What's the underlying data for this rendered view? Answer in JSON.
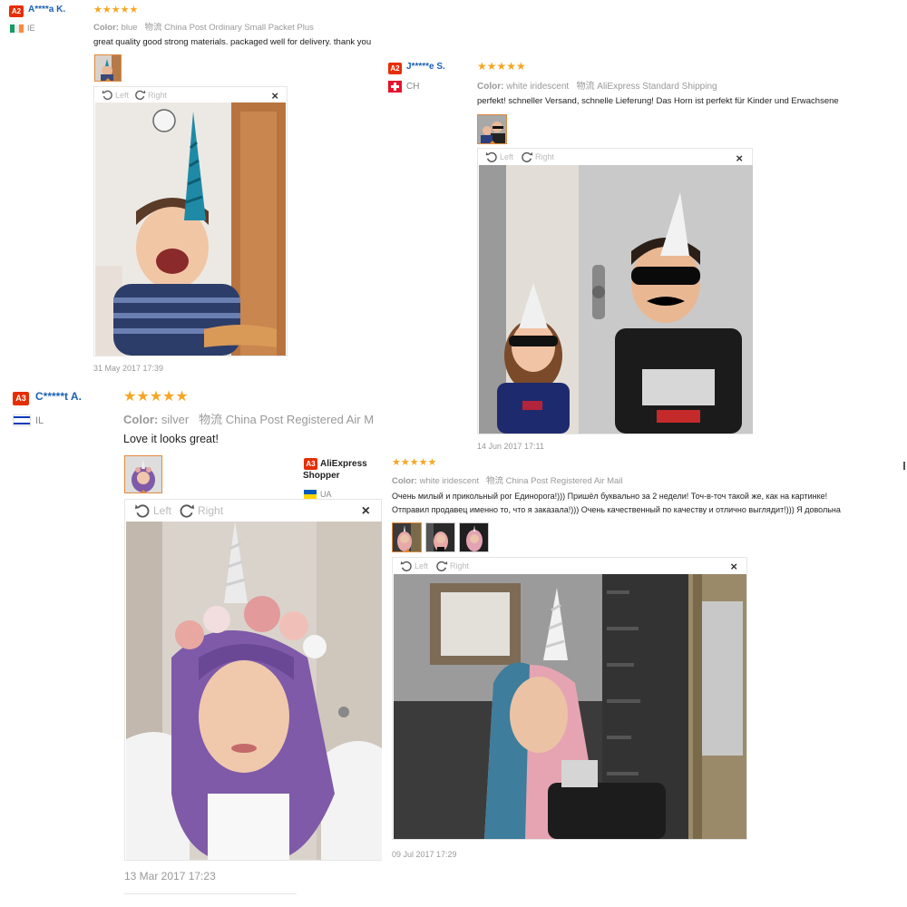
{
  "reviews": [
    {
      "badge": "A2",
      "name": "A****a K.",
      "country": "IE",
      "stars": "★★★★★",
      "color_label": "Color:",
      "color_value": "blue",
      "ship_icon": "物流",
      "shipping": "China Post Ordinary Small Packet Plus",
      "text": "great quality good strong materials. packaged well for delivery. thank you",
      "viewer": {
        "left": "Left",
        "right": "Right",
        "close": "×"
      },
      "date": "31 May 2017 17:39"
    },
    {
      "badge": "A2",
      "name": "J*****e S.",
      "country": "CH",
      "stars": "★★★★★",
      "color_label": "Color:",
      "color_value": "white iridescent",
      "ship_icon": "物流",
      "shipping": "AliExpress Standard Shipping",
      "text": "perfekt! schneller Versand, schnelle Lieferung! Das Horn ist perfekt für Kinder und Erwachsene",
      "viewer": {
        "left": "Left",
        "right": "Right",
        "close": "×"
      },
      "date": "14 Jun 2017 17:11"
    },
    {
      "badge": "A3",
      "name": "C*****t A.",
      "country": "IL",
      "stars": "★★★★★",
      "color_label": "Color:",
      "color_value": "silver",
      "ship_icon": "物流",
      "shipping": "China Post Registered Air M",
      "text": "Love it looks great!",
      "viewer": {
        "left": "Left",
        "right": "Right",
        "close": "×"
      },
      "date": "13 Mar 2017 17:23"
    },
    {
      "badge": "A3",
      "name": "AliExpress Shopper",
      "name_line1": "AliExpress",
      "name_line2": "Shopper",
      "country": "UA",
      "stars": "★★★★★",
      "color_label": "Color:",
      "color_value": "white iridescent",
      "ship_icon": "物流",
      "shipping": "China Post Registered Air Mail",
      "text_line1": "Очень милый и прикольный рог Единорога!))) Пришёл буквально за 2 недели! Точ-в-точ такой же, как на картинке!",
      "text_line2": "Отправил продавец именно то, что я заказала!))) Очень качественный по качеству и отлично выглядит!))) Я довольна",
      "viewer": {
        "left": "Left",
        "right": "Right",
        "close": "×"
      },
      "date": "09 Jul 2017 17:29"
    }
  ],
  "colors": {
    "accent": "#e62e04",
    "name": "#1a5fb4",
    "star": "#f5a623",
    "meta": "#999999"
  }
}
